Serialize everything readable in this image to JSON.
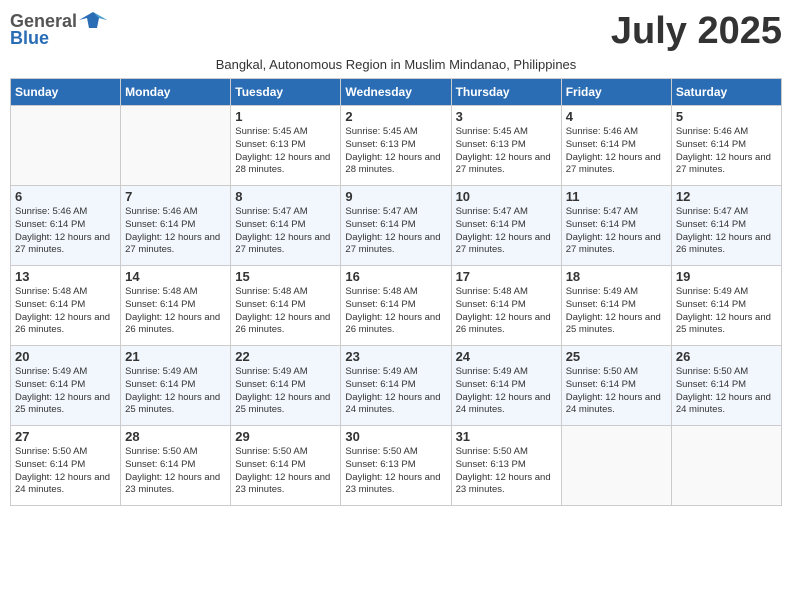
{
  "header": {
    "logo_general": "General",
    "logo_blue": "Blue",
    "title": "July 2025",
    "subtitle": "Bangkal, Autonomous Region in Muslim Mindanao, Philippines"
  },
  "days_of_week": [
    "Sunday",
    "Monday",
    "Tuesday",
    "Wednesday",
    "Thursday",
    "Friday",
    "Saturday"
  ],
  "weeks": [
    [
      {
        "day": "",
        "info": ""
      },
      {
        "day": "",
        "info": ""
      },
      {
        "day": "1",
        "info": "Sunrise: 5:45 AM\nSunset: 6:13 PM\nDaylight: 12 hours and 28 minutes."
      },
      {
        "day": "2",
        "info": "Sunrise: 5:45 AM\nSunset: 6:13 PM\nDaylight: 12 hours and 28 minutes."
      },
      {
        "day": "3",
        "info": "Sunrise: 5:45 AM\nSunset: 6:13 PM\nDaylight: 12 hours and 27 minutes."
      },
      {
        "day": "4",
        "info": "Sunrise: 5:46 AM\nSunset: 6:14 PM\nDaylight: 12 hours and 27 minutes."
      },
      {
        "day": "5",
        "info": "Sunrise: 5:46 AM\nSunset: 6:14 PM\nDaylight: 12 hours and 27 minutes."
      }
    ],
    [
      {
        "day": "6",
        "info": "Sunrise: 5:46 AM\nSunset: 6:14 PM\nDaylight: 12 hours and 27 minutes."
      },
      {
        "day": "7",
        "info": "Sunrise: 5:46 AM\nSunset: 6:14 PM\nDaylight: 12 hours and 27 minutes."
      },
      {
        "day": "8",
        "info": "Sunrise: 5:47 AM\nSunset: 6:14 PM\nDaylight: 12 hours and 27 minutes."
      },
      {
        "day": "9",
        "info": "Sunrise: 5:47 AM\nSunset: 6:14 PM\nDaylight: 12 hours and 27 minutes."
      },
      {
        "day": "10",
        "info": "Sunrise: 5:47 AM\nSunset: 6:14 PM\nDaylight: 12 hours and 27 minutes."
      },
      {
        "day": "11",
        "info": "Sunrise: 5:47 AM\nSunset: 6:14 PM\nDaylight: 12 hours and 27 minutes."
      },
      {
        "day": "12",
        "info": "Sunrise: 5:47 AM\nSunset: 6:14 PM\nDaylight: 12 hours and 26 minutes."
      }
    ],
    [
      {
        "day": "13",
        "info": "Sunrise: 5:48 AM\nSunset: 6:14 PM\nDaylight: 12 hours and 26 minutes."
      },
      {
        "day": "14",
        "info": "Sunrise: 5:48 AM\nSunset: 6:14 PM\nDaylight: 12 hours and 26 minutes."
      },
      {
        "day": "15",
        "info": "Sunrise: 5:48 AM\nSunset: 6:14 PM\nDaylight: 12 hours and 26 minutes."
      },
      {
        "day": "16",
        "info": "Sunrise: 5:48 AM\nSunset: 6:14 PM\nDaylight: 12 hours and 26 minutes."
      },
      {
        "day": "17",
        "info": "Sunrise: 5:48 AM\nSunset: 6:14 PM\nDaylight: 12 hours and 26 minutes."
      },
      {
        "day": "18",
        "info": "Sunrise: 5:49 AM\nSunset: 6:14 PM\nDaylight: 12 hours and 25 minutes."
      },
      {
        "day": "19",
        "info": "Sunrise: 5:49 AM\nSunset: 6:14 PM\nDaylight: 12 hours and 25 minutes."
      }
    ],
    [
      {
        "day": "20",
        "info": "Sunrise: 5:49 AM\nSunset: 6:14 PM\nDaylight: 12 hours and 25 minutes."
      },
      {
        "day": "21",
        "info": "Sunrise: 5:49 AM\nSunset: 6:14 PM\nDaylight: 12 hours and 25 minutes."
      },
      {
        "day": "22",
        "info": "Sunrise: 5:49 AM\nSunset: 6:14 PM\nDaylight: 12 hours and 25 minutes."
      },
      {
        "day": "23",
        "info": "Sunrise: 5:49 AM\nSunset: 6:14 PM\nDaylight: 12 hours and 24 minutes."
      },
      {
        "day": "24",
        "info": "Sunrise: 5:49 AM\nSunset: 6:14 PM\nDaylight: 12 hours and 24 minutes."
      },
      {
        "day": "25",
        "info": "Sunrise: 5:50 AM\nSunset: 6:14 PM\nDaylight: 12 hours and 24 minutes."
      },
      {
        "day": "26",
        "info": "Sunrise: 5:50 AM\nSunset: 6:14 PM\nDaylight: 12 hours and 24 minutes."
      }
    ],
    [
      {
        "day": "27",
        "info": "Sunrise: 5:50 AM\nSunset: 6:14 PM\nDaylight: 12 hours and 24 minutes."
      },
      {
        "day": "28",
        "info": "Sunrise: 5:50 AM\nSunset: 6:14 PM\nDaylight: 12 hours and 23 minutes."
      },
      {
        "day": "29",
        "info": "Sunrise: 5:50 AM\nSunset: 6:14 PM\nDaylight: 12 hours and 23 minutes."
      },
      {
        "day": "30",
        "info": "Sunrise: 5:50 AM\nSunset: 6:13 PM\nDaylight: 12 hours and 23 minutes."
      },
      {
        "day": "31",
        "info": "Sunrise: 5:50 AM\nSunset: 6:13 PM\nDaylight: 12 hours and 23 minutes."
      },
      {
        "day": "",
        "info": ""
      },
      {
        "day": "",
        "info": ""
      }
    ]
  ]
}
